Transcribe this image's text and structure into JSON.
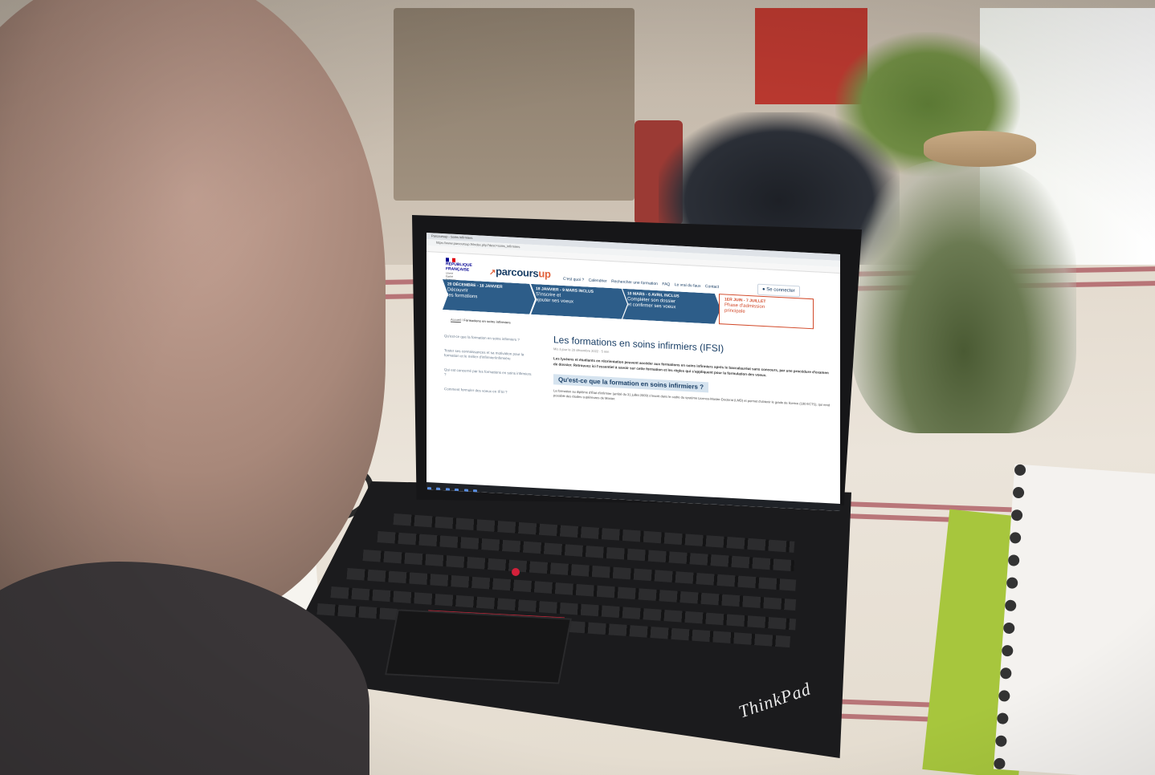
{
  "browser": {
    "tab_title": "Parcoursup - Soins infirmiers",
    "url": "https://www.parcoursup.fr/index.php?desc=soins_infirmiers"
  },
  "site": {
    "gov_logo_lines": [
      "RÉPUBLIQUE",
      "FRANÇAISE"
    ],
    "gov_motto": [
      "Liberté",
      "Égalité",
      "Fraternité"
    ],
    "logo_text_a": "parcours",
    "logo_text_b": "up",
    "nav": [
      "C'est quoi ?",
      "Calendrier",
      "Rechercher une formation",
      "FAQ",
      "Le vrai du faux",
      "Contact"
    ],
    "connect_label": "Se connecter"
  },
  "steps": [
    {
      "date": "20 DÉCEMBRE - 18 JANVIER",
      "label_1": "Découvrir",
      "label_2": "les formations"
    },
    {
      "date": "18 JANVIER - 9 MARS INCLUS",
      "label_1": "S'inscrire et",
      "label_2": "ajouter ses voeux"
    },
    {
      "date": "10 MARS - 6 AVRIL INCLUS",
      "label_1": "Compléter son dossier",
      "label_2": "et confirmer ses voeux"
    },
    {
      "date": "1ER JUIN - 7 JUILLET",
      "label_1": "Phase d'admission",
      "label_2": "principale"
    }
  ],
  "breadcrumb": {
    "home": "Accueil",
    "sep": "/",
    "current": "Formations en soins infirmiers"
  },
  "sidebar": [
    "Qu'est-ce que la formation en soins infirmiers ?",
    "Tester ses connaissances et sa motivation pour la formation et le métier d'infirmier/infirmière",
    "Qui est concerné par les formations en soins infirmiers ?",
    "Comment formuler des voeux en IFSI ?"
  ],
  "article": {
    "title": "Les formations en soins infirmiers (IFSI)",
    "meta": "Mis à jour le 20 décembre 2022 · 5 min",
    "lead": "Les lycéens et étudiants en réorientation peuvent accéder aux formations en soins infirmiers après le baccalauréat sans concours, par une procédure d'examen de dossier. Retrouvez ici l'essentiel à savoir sur cette formation et les règles qui s'appliquent pour la formulation des voeux.",
    "h2": "Qu'est-ce que la formation en soins infirmiers ?",
    "body": "La formation au diplôme d'État d'infirmier (arrêté du 31 juillet 2009) s'inscrit dans le cadre du système Licence-Master-Doctorat (LMD) et permet d'obtenir le grade de licence (180 ECTS), qui rend possible des études supérieures de Master."
  },
  "laptop": {
    "brand": "ThinkPad"
  },
  "colors": {
    "gov_blue": "#000091",
    "ps_navy": "#1a3f66",
    "ps_orange": "#e1623c",
    "step_blue": "#2d5d89",
    "step_red": "#d24a2a"
  }
}
